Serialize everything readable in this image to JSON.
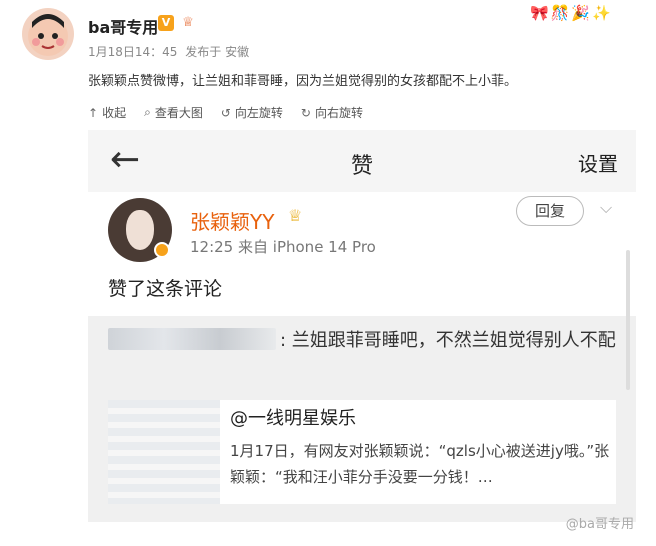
{
  "post": {
    "username": "ba哥专用",
    "badge": "V",
    "crown": "♕",
    "time": "1月18日14：45",
    "location": "发布于 安徽",
    "text": "张颖颖点赞微博，让兰姐和菲哥睡，因为兰姐觉得别的女孩都配不上小菲。",
    "decoration": "🎀🎊🎉✨"
  },
  "toolbar": {
    "collapse": "收起",
    "view_large": "查看大图",
    "rotate_left": "向左旋转",
    "rotate_right": "向右旋转"
  },
  "screenshot": {
    "title": "赞",
    "settings": "设置",
    "back_icon": "←",
    "user": {
      "name": "张颖颖YY",
      "time": "12:25",
      "device": "来自 iPhone 14 Pro",
      "reply": "回复"
    },
    "liked_text": "赞了这条评论",
    "comment": ": 兰姐跟菲哥睡吧，不然兰姐觉得别人不配",
    "embed": {
      "title": "@一线明星娱乐",
      "body": "1月17日，有网友对张颖颖说：“qzls小心被送进jy哦。”张颖颖：“我和汪小菲分手没要一分钱！…"
    }
  },
  "watermark": "@ba哥专用",
  "colors": {
    "name_accent": "#e8610d",
    "badge": "#f7a21b"
  }
}
